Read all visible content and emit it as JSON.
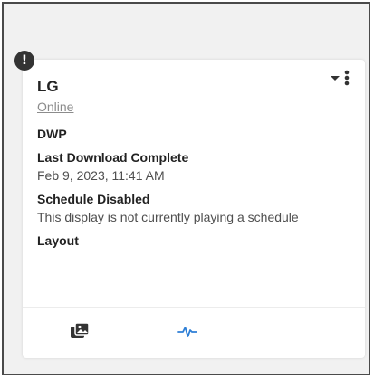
{
  "display": {
    "name": "LG",
    "status": "Online"
  },
  "details": {
    "group_name": "DWP",
    "last_download_label": "Last Download Complete",
    "last_download_time": "Feb 9, 2023, 11:41 AM",
    "schedule_label": "Schedule Disabled",
    "schedule_message": "This display is not currently playing a schedule",
    "layout_label": "Layout"
  },
  "alert": {
    "symbol": "!"
  },
  "icons": {
    "menu": "dropdown-menu-icon",
    "images": "images-icon",
    "activity": "activity-pulse-icon"
  },
  "colors": {
    "accent": "#2e7fd6",
    "status_gray": "#8c8c8c",
    "alert_badge": "#333333"
  }
}
